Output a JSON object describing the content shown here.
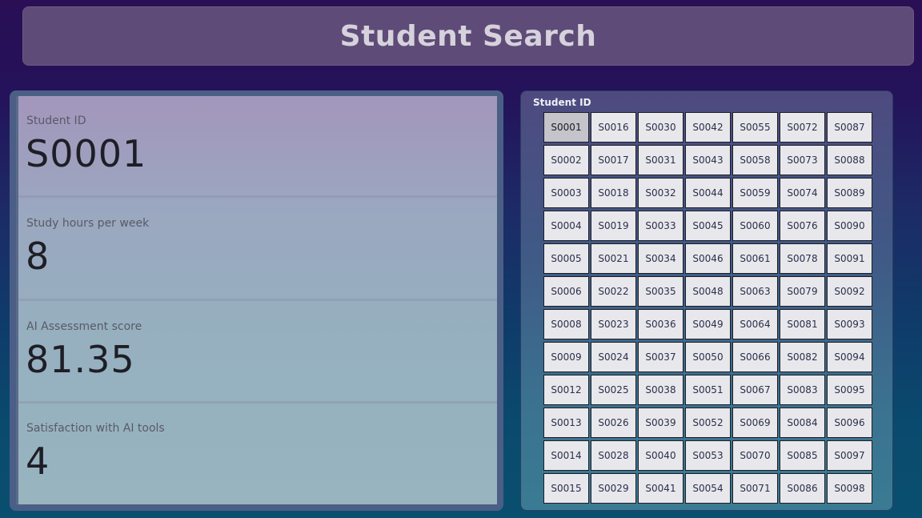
{
  "header": {
    "title": "Student Search"
  },
  "cards": [
    {
      "label": "Student ID",
      "value": "S0001"
    },
    {
      "label": "Study hours per week",
      "value": "8"
    },
    {
      "label": "AI Assessment score",
      "value": "81.35"
    },
    {
      "label": "Satisfaction with AI tools",
      "value": "4"
    }
  ],
  "slicer": {
    "title": "Student ID",
    "selected": "S0001",
    "rows": [
      [
        "S0001",
        "S0016",
        "S0030",
        "S0042",
        "S0055",
        "S0072",
        "S0087"
      ],
      [
        "S0002",
        "S0017",
        "S0031",
        "S0043",
        "S0058",
        "S0073",
        "S0088"
      ],
      [
        "S0003",
        "S0018",
        "S0032",
        "S0044",
        "S0059",
        "S0074",
        "S0089"
      ],
      [
        "S0004",
        "S0019",
        "S0033",
        "S0045",
        "S0060",
        "S0076",
        "S0090"
      ],
      [
        "S0005",
        "S0021",
        "S0034",
        "S0046",
        "S0061",
        "S0078",
        "S0091"
      ],
      [
        "S0006",
        "S0022",
        "S0035",
        "S0048",
        "S0063",
        "S0079",
        "S0092"
      ],
      [
        "S0008",
        "S0023",
        "S0036",
        "S0049",
        "S0064",
        "S0081",
        "S0093"
      ],
      [
        "S0009",
        "S0024",
        "S0037",
        "S0050",
        "S0066",
        "S0082",
        "S0094"
      ],
      [
        "S0012",
        "S0025",
        "S0038",
        "S0051",
        "S0067",
        "S0083",
        "S0095"
      ],
      [
        "S0013",
        "S0026",
        "S0039",
        "S0052",
        "S0069",
        "S0084",
        "S0096"
      ],
      [
        "S0014",
        "S0028",
        "S0040",
        "S0053",
        "S0070",
        "S0085",
        "S0097"
      ],
      [
        "S0015",
        "S0029",
        "S0041",
        "S0054",
        "S0071",
        "S0086",
        "S0098"
      ]
    ]
  },
  "colors": {
    "background_top": "#2a0f55",
    "background_bottom": "#0a4f6f",
    "banner": "#5e4b78",
    "card_panel": "#4b5f86",
    "slicer_button": "#e8e8ec",
    "slicer_selected": "#c4c4ca"
  }
}
